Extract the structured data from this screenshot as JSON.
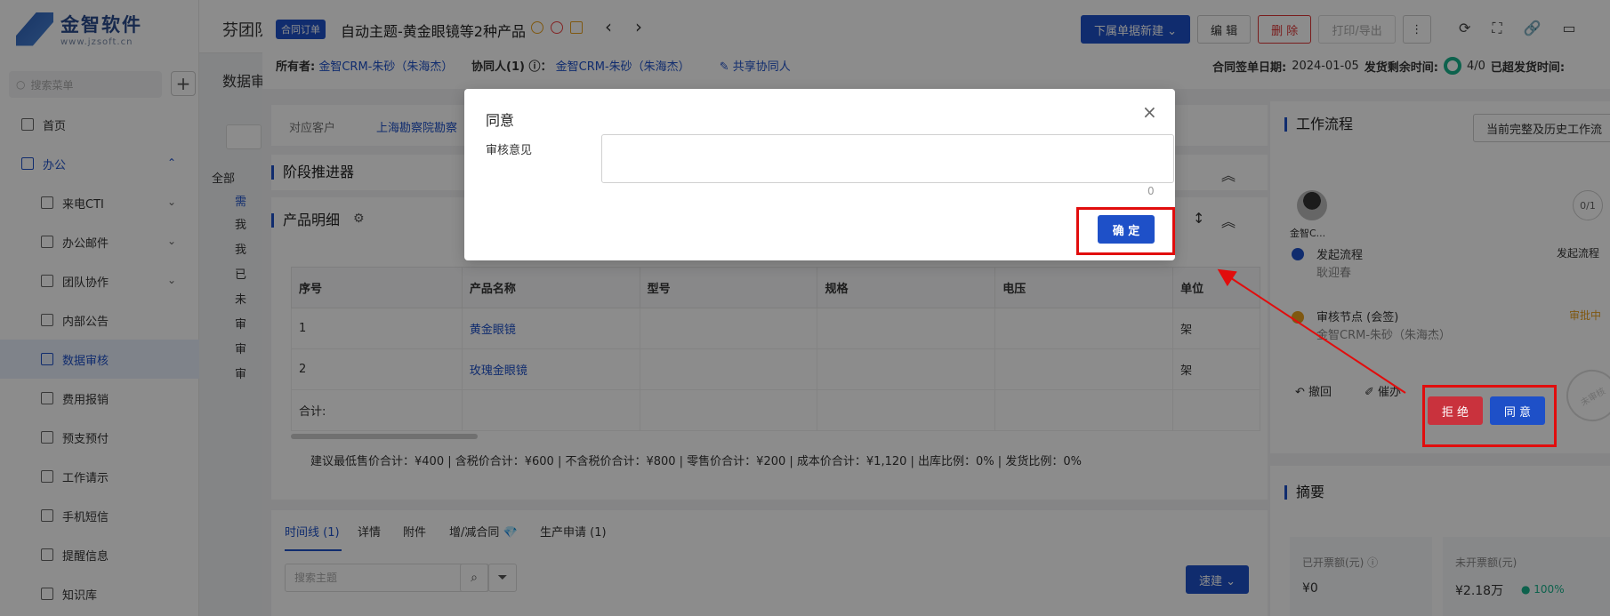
{
  "sidebar": {
    "logo_title": "金智软件",
    "logo_url": "www.jzsoft.cn",
    "search_placeholder": "搜索菜单",
    "add_label": "+",
    "items": [
      {
        "label": "首页",
        "type": "top"
      },
      {
        "label": "办公",
        "type": "group"
      },
      {
        "label": "来电CTI",
        "type": "sub",
        "chevron": "⌄"
      },
      {
        "label": "办公邮件",
        "type": "sub",
        "chevron": "⌄"
      },
      {
        "label": "团队协作",
        "type": "sub",
        "chevron": "⌄"
      },
      {
        "label": "内部公告",
        "type": "sub"
      },
      {
        "label": "数据审核",
        "type": "sub active"
      },
      {
        "label": "费用报销",
        "type": "sub"
      },
      {
        "label": "预支预付",
        "type": "sub"
      },
      {
        "label": "工作请示",
        "type": "sub"
      },
      {
        "label": "手机短信",
        "type": "sub"
      },
      {
        "label": "提醒信息",
        "type": "sub"
      },
      {
        "label": "知识库",
        "type": "sub"
      }
    ],
    "group_chevron": "⌃"
  },
  "background": {
    "topbar_title": "芬团队",
    "subhead": "数据审",
    "tree_items": [
      "全部",
      "需",
      "我",
      "我",
      "已",
      "未",
      "审",
      "审",
      "审"
    ]
  },
  "drawer": {
    "tag": "合同订单",
    "title": "自动主题-黄金眼镜等2种产品",
    "buttons": {
      "new_sub": "下属单据新建 ⌄",
      "edit": "编 辑",
      "delete": "删 除",
      "print": "打印/导出",
      "more": "⋮"
    },
    "tool_icons": [
      "⟳",
      "⛶",
      "🔗",
      "▭",
      "⎋"
    ],
    "meta": {
      "owner_label": "所有者:",
      "owner": "金智CRM-朱砂（朱海杰）",
      "collab_label": "协同人(1) ⓘ：",
      "collab": "金智CRM-朱砂（朱海杰）",
      "share": "✎ 共享协同人",
      "sign_date_label": "合同签单日期:",
      "sign_date": "2024-01-05",
      "ship_label": "发货剩余时间:",
      "ship_value": "4/0",
      "over_label": "已超发货时间:"
    },
    "customer": {
      "label": "对应客户",
      "value": "上海勘察院勘察"
    },
    "stage_title": "阶段推进器",
    "product_title": "产品明细",
    "product_table": {
      "headers": [
        "序号",
        "产品名称",
        "型号",
        "规格",
        "电压",
        "单位"
      ],
      "rows": [
        [
          "1",
          "黄金眼镜",
          "",
          "",
          "",
          "架"
        ],
        [
          "2",
          "玫瑰金眼镜",
          "",
          "",
          "",
          "架"
        ],
        [
          "合计:",
          "",
          "",
          "",
          "",
          ""
        ]
      ]
    },
    "totals": "建议最低售价合计：¥400 |    含税价合计：¥600 |    不含税价合计：¥800 |    零售价合计：¥200 |    成本价合计：¥1,120 |    出库比例：0% |    发货比例：0%",
    "tabs": [
      {
        "label": "时间线 (1)",
        "active": true
      },
      {
        "label": "详情"
      },
      {
        "label": "附件"
      },
      {
        "label": "增/减合同 💎"
      },
      {
        "label": "生产申请 (1)"
      }
    ],
    "search_placeholder": "搜索主题",
    "quick_new": "速建 ⌄"
  },
  "workflow": {
    "title": "工作流程",
    "history_btn": "当前完整及历史工作流",
    "avatar_name": "金智C...",
    "counter": "0/1",
    "steps": [
      {
        "title": "发起流程",
        "person": "耿迎春",
        "status": "发起流程"
      },
      {
        "title": "审核节点 (会签)",
        "person": "金智CRM-朱砂（朱海杰）",
        "status": "审批中"
      }
    ],
    "revoke": "撤回",
    "urge": "催办",
    "reject": "拒 绝",
    "agree": "同 意",
    "stamp": "未审核"
  },
  "summary": {
    "title": "摘要",
    "invoiced_label": "已开票额(元) ⓘ",
    "invoiced_value": "¥0",
    "uninvoiced_label": "未开票额(元)",
    "uninvoiced_value": "¥2.18万",
    "uninvoiced_pct": "● 100%"
  },
  "modal": {
    "title": "同意",
    "close": "×",
    "field_label": "审核意见",
    "textarea_value": "",
    "char_count": "0",
    "ok": "确 定"
  },
  "colors": {
    "brand": "#1e50c8",
    "danger": "#d33a3a",
    "highlight": "#e10d0d"
  }
}
